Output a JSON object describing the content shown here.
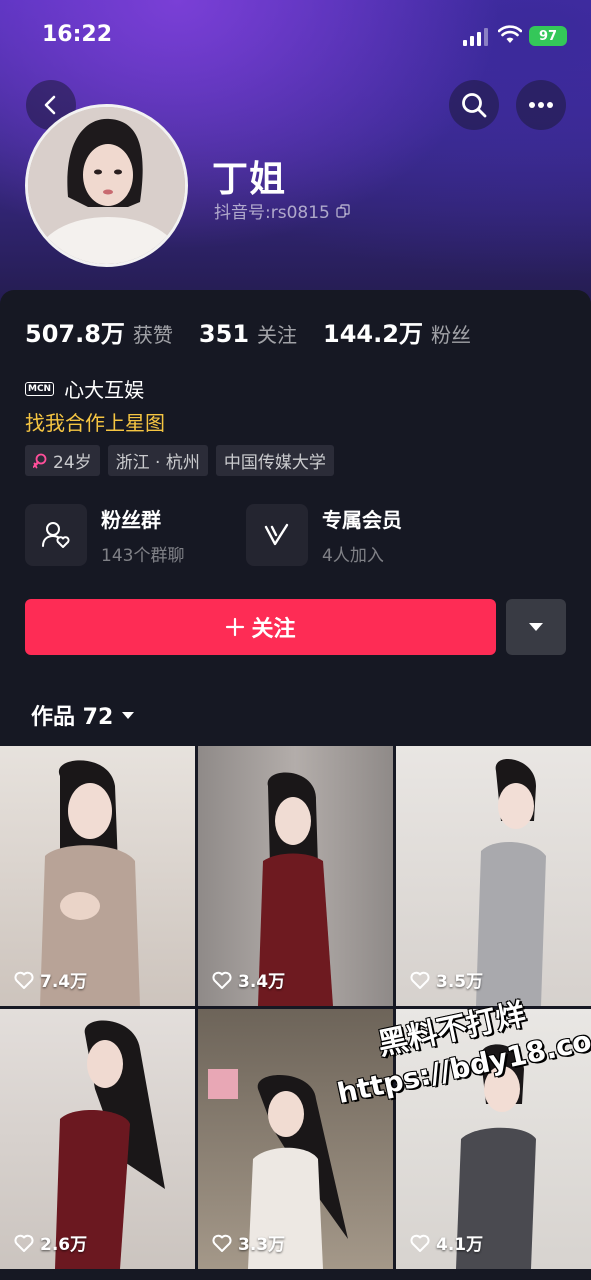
{
  "status_bar": {
    "time": "16:22",
    "battery": "97"
  },
  "profile": {
    "name": "丁姐",
    "douyin_id": "抖音号:rs0815",
    "stats": [
      {
        "value": "507.8万",
        "label": "获赞"
      },
      {
        "value": "351",
        "label": "关注"
      },
      {
        "value": "144.2万",
        "label": "粉丝"
      }
    ],
    "mcn_badge": "MCN",
    "mcn_name": "心大互娱",
    "xingtu_link": "找我合作上星图",
    "tags": [
      "24岁",
      "浙江 · 杭州",
      "中国传媒大学"
    ]
  },
  "features": [
    {
      "title": "粉丝群",
      "subtitle": "143个群聊"
    },
    {
      "title": "专属会员",
      "subtitle": "4人加入"
    }
  ],
  "follow_button": "关注",
  "works_tab": {
    "label": "作品 72"
  },
  "videos": [
    {
      "likes": "7.4万"
    },
    {
      "likes": "3.4万"
    },
    {
      "likes": "3.5万"
    },
    {
      "likes": "2.6万"
    },
    {
      "likes": "3.3万"
    },
    {
      "likes": "4.1万"
    }
  ],
  "watermark": {
    "line1": "黑料不打烊",
    "line2": "https://bdy18.co"
  },
  "colors": {
    "accent": "#fe2c55",
    "link": "#f5c542",
    "background": "#161823"
  }
}
